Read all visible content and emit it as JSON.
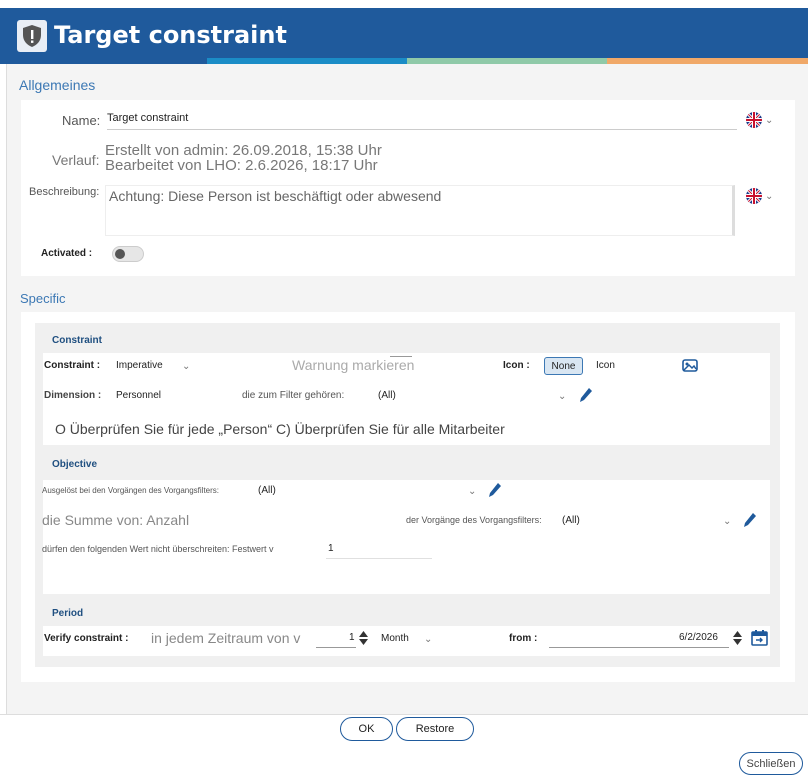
{
  "window": {
    "title": "Target constraint"
  },
  "colors": {
    "header": "#1f5a9c",
    "accent": "#3c78b4"
  },
  "general": {
    "section_title": "Allgemeines",
    "name_label": "Name:",
    "name_value": "Target constraint",
    "history_label": "Verlauf:",
    "history_created": "Erstellt von admin: 26.09.2018, 15:38 Uhr",
    "history_edited": "Bearbeitet von LHO: 2.6.2026, 18:17 Uhr",
    "description_label": "Beschreibung:",
    "description_value": "Achtung: Diese Person ist beschäftigt oder abwesend",
    "activated_label": "Activated :",
    "activated": false
  },
  "specific": {
    "section_title": "Specific",
    "constraint": {
      "heading": "Constraint",
      "constraint_label": "Constraint :",
      "constraint_value": "Imperative",
      "warning_text": "Warnung markieren",
      "icon_label": "Icon :",
      "icon_none": "None",
      "icon_option": "Icon",
      "dimension_label": "Dimension :",
      "dimension_value": "Personnel",
      "filter_label": "die zum Filter gehören:",
      "filter_value": "(All)",
      "check_text": "O Überprüfen Sie für jede „Person“ C) Überprüfen Sie für alle Mitarbeiter"
    },
    "objective": {
      "heading": "Objective",
      "triggered_label": "Ausgelöst bei den Vorgängen des Vorgangsfilters:",
      "triggered_value": "(All)",
      "sum_text": "die Summe von: Anzahl",
      "process_filter_label": "der Vorgänge des Vorgangsfilters:",
      "process_filter_value": "(All)",
      "limit_label": "dürfen den folgenden Wert nicht überschreiten: Festwert v",
      "limit_value": "1"
    },
    "period": {
      "heading": "Period",
      "verify_label": "Verify constraint :",
      "every_text": "in jedem Zeitraum von v",
      "period_count": "1",
      "period_unit": "Month",
      "from_label": "from :",
      "from_value": "6/2/2026"
    }
  },
  "footer": {
    "ok": "OK",
    "restore": "Restore",
    "close": "Schließen"
  }
}
